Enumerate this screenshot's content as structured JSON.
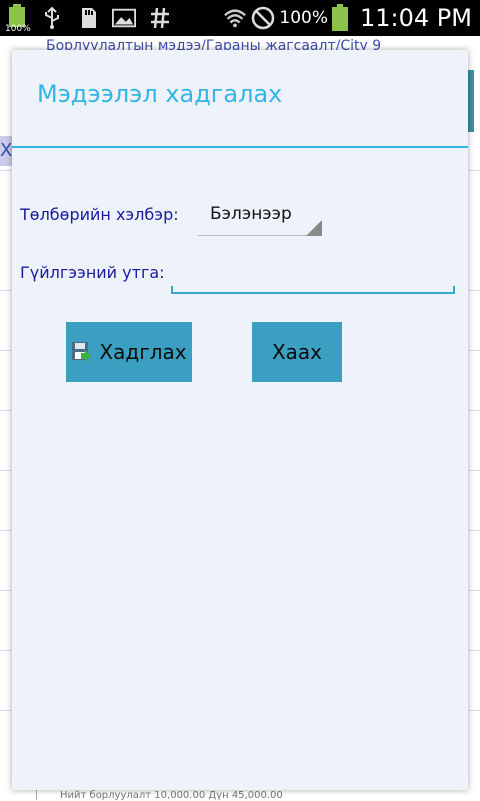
{
  "status_bar": {
    "battery_small_label": "100%",
    "battery_percent": "100%",
    "time": "11:04 PM"
  },
  "background": {
    "header_text": "Борлуулалтын мэдээ/Гараны жагсаалт/City 9",
    "row_marker": "Х",
    "footer_text": "Нийт борлуулалт 10,000.00 Дүн 45,000.00"
  },
  "dialog": {
    "title": "Мэдээлэл хадгалах",
    "payment_label": "Төлбөрийн хэлбэр:",
    "payment_value": "Бэлэнээр",
    "amount_label": "Гүйлгээний утга:",
    "amount_value": "",
    "save_button_label": "Хадглах",
    "close_button_label": "Хаах"
  },
  "colors": {
    "accent": "#33b5e5",
    "button": "#3a9fc0",
    "label": "#1a1a9e",
    "battery": "#8bc34a"
  },
  "icons": [
    "battery-icon",
    "usb-icon",
    "sd-card-icon",
    "image-icon",
    "hash-icon",
    "wifi-icon",
    "block-icon",
    "save-icon"
  ]
}
